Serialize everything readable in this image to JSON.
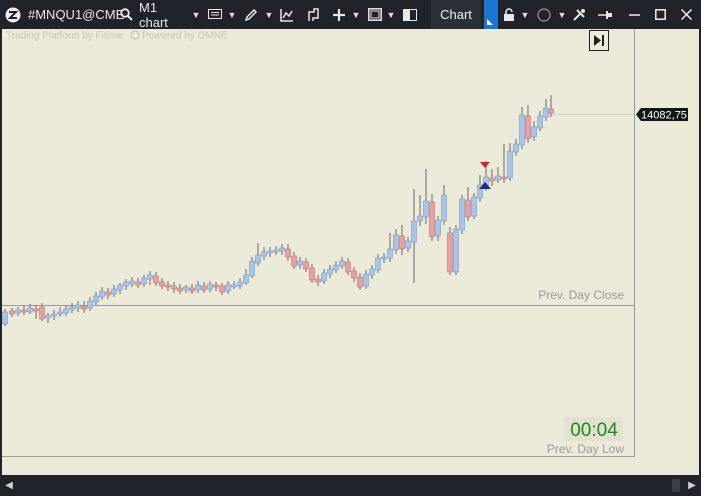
{
  "toolbar": {
    "symbol": "#MNQU1@CME",
    "timeframe": "M1 chart",
    "chart_button": "Chart",
    "icons": [
      "app-logo-icon",
      "search-icon",
      "template-icon",
      "pencil-icon",
      "indicator-icon",
      "trade-icon",
      "crosshair-icon",
      "window-icon",
      "layout-icon",
      "lock-icon",
      "circle-icon",
      "tools-icon",
      "pin-icon",
      "minimize-icon",
      "maximize-icon",
      "close-icon"
    ]
  },
  "chart": {
    "watermark_left": "Trading Platform by Fitime",
    "watermark_right": "Powered by OMNE",
    "price_label": "14082,75",
    "prev_day_close": "Prev. Day Close",
    "prev_day_low": "Prev. Day Low",
    "timer": "00:04",
    "bull_color": "#a8c4e8",
    "bear_color": "#e6a0a0",
    "timer_color": "#1a8a1a",
    "sell_marker_color": "#e02020",
    "buy_marker_color": "#1a2a8a"
  }
}
